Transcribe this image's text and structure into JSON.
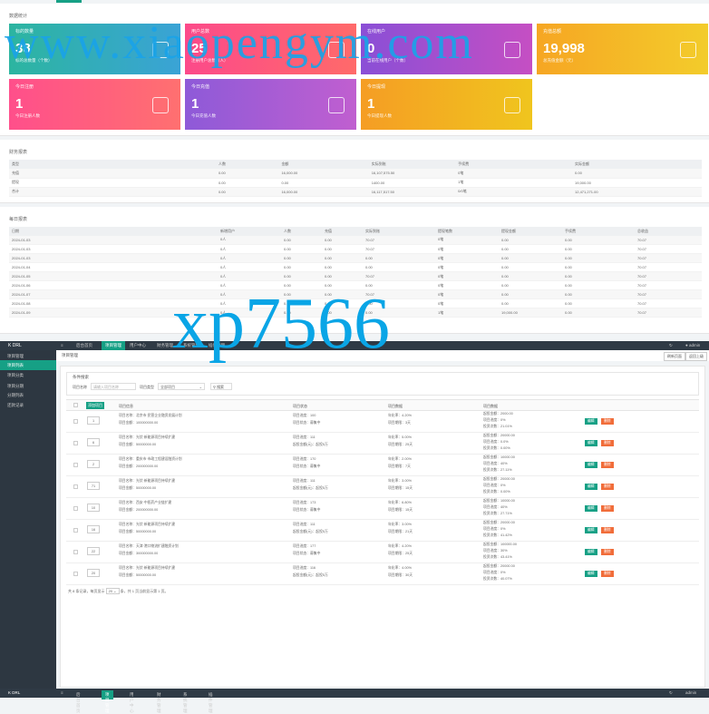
{
  "stats": {
    "title": "数据统计",
    "cards": [
      {
        "label": "标的数量",
        "value": "38",
        "sub": "标的总数量（个数）",
        "icon": "layers-icon",
        "cls": "g1"
      },
      {
        "label": "用户总数",
        "value": "25",
        "sub": "注册用户总数（人）",
        "icon": "user-icon",
        "cls": "g2"
      },
      {
        "label": "在线用户",
        "value": "0",
        "sub": "当前在线用户（个数）",
        "icon": "book-icon",
        "cls": "g3"
      },
      {
        "label": "充值总额",
        "value": "19,998",
        "sub": "总充值金额（元）",
        "icon": "edit-icon",
        "cls": "g4"
      },
      {
        "label": "今日注册",
        "value": "1",
        "sub": "今日注册人数",
        "icon": "user-icon",
        "cls": "g5"
      },
      {
        "label": "今日充值",
        "value": "1",
        "sub": "今日充值人数",
        "icon": "book-icon",
        "cls": "g6"
      },
      {
        "label": "今日提现",
        "value": "1",
        "sub": "今日提现人数",
        "icon": "edit-icon",
        "cls": "g7"
      }
    ]
  },
  "summary": {
    "title": "财务报表",
    "headers": [
      "类型",
      "",
      "人数",
      "金额",
      "实际到账",
      "",
      "手续费",
      "实际金额"
    ],
    "rows": [
      [
        "充值",
        "",
        "0.00",
        "16,000.00",
        "16,107,575.50",
        "",
        "0笔",
        "0.00"
      ],
      [
        "提现",
        "",
        "0.00",
        "0.00",
        "1400.00",
        "",
        "1笔",
        "19,000.00"
      ],
      [
        "合计",
        "",
        "0.00",
        "16,000.00",
        "16,117,517.50",
        "",
        "0/0笔",
        "12,471,271.00"
      ]
    ]
  },
  "daily": {
    "title": "每日报表",
    "headers": [
      "日期",
      "",
      "新增用户",
      "人数",
      "充值",
      "实际到账",
      "提现笔数",
      "提现金额",
      "手续费",
      "总收益"
    ],
    "rows": [
      [
        "2024-01-03",
        "",
        "0人",
        "0.00",
        "0.00",
        "70.07",
        "0笔",
        "0.00",
        "0.00",
        "70.07"
      ],
      [
        "2024-01-03",
        "",
        "0人",
        "0.00",
        "0.00",
        "70.07",
        "0笔",
        "0.00",
        "0.00",
        "70.07"
      ],
      [
        "2024-01-03",
        "",
        "0人",
        "0.00",
        "0.00",
        "0.00",
        "0笔",
        "0.00",
        "0.00",
        "70.07"
      ],
      [
        "2024-01-04",
        "",
        "0人",
        "0.00",
        "0.00",
        "0.00",
        "0笔",
        "0.00",
        "0.00",
        "70.07"
      ],
      [
        "2024-01-05",
        "",
        "0人",
        "0.00",
        "0.00",
        "70.07",
        "0笔",
        "0.00",
        "0.00",
        "70.07"
      ],
      [
        "2024-01-06",
        "",
        "0人",
        "0.00",
        "0.00",
        "0.00",
        "0笔",
        "0.00",
        "0.00",
        "70.07"
      ],
      [
        "2024-01-07",
        "",
        "0人",
        "0.00",
        "0.00",
        "70.07",
        "0笔",
        "0.00",
        "0.00",
        "70.07"
      ],
      [
        "2024-01-08",
        "",
        "0人",
        "0.00",
        "0.00",
        "0.00",
        "0笔",
        "0.00",
        "0.00",
        "70.07"
      ],
      [
        "2024-01-09",
        "",
        "0人",
        "0.00",
        "0.00",
        "0.00",
        "1笔",
        "19,000.00",
        "0.00",
        "70.07"
      ]
    ]
  },
  "watermark": {
    "line1": "www.xiaopengym.com",
    "line2": "xp7566"
  },
  "nav": {
    "logo": "K DRL",
    "home_icon": "home-icon",
    "items": [
      "后台首页",
      "项目管理",
      "用户中心",
      "财务管理",
      "系统管理",
      "插件管理"
    ],
    "active": 1,
    "user": "admin"
  },
  "sidebar": {
    "groups": [
      {
        "title": "项目管理",
        "items": [
          "项目列表",
          "项目分类"
        ],
        "active": 0
      },
      {
        "title": "项目分期",
        "items": [
          "分期列表",
          "还款记录"
        ]
      }
    ]
  },
  "content": {
    "breadcrumb": "项目管理",
    "btn_refresh": "刷新页面",
    "btn_back": "返回上级",
    "search": {
      "title": "条件搜索",
      "label1": "项目名称",
      "placeholder1": "请输入项目名称",
      "label2": "项目类型",
      "select": "全部项目",
      "button": "搜索"
    },
    "table": {
      "add_label": "添加项目",
      "headers": [
        "项目信息",
        "项目状态",
        "项目数据",
        "项目数据"
      ],
      "rows": [
        {
          "sort": "1",
          "c1": "项目名称：北京市·民营企业融资发展计划",
          "c1b": "项目金额：100000000.00",
          "c2": "项目进度：100",
          "c2b": "项目状态：募集中",
          "c3": "年化率：4.20%",
          "c3b": "项目期限：3天",
          "c4": "起投金额：2000.00",
          "c4b": "项目进度：0%",
          "c4c": "投资次数：21.01%"
        },
        {
          "sort": "6",
          "c1": "项目名称：光伏·新能源项目持续扩建",
          "c1b": "项目金额：50000000.00",
          "c2": "项目进度：111",
          "c2b": "起投金额(元)：起投5万",
          "c3": "年化率：5.00%",
          "c3b": "项目期限：25天",
          "c4": "起投金额：20000.00",
          "c4b": "项目进度：0.0%",
          "c4c": "投资次数：0.00%"
        },
        {
          "sort": "2",
          "c1": "项目名称：重庆市·市政工程建设融资计划",
          "c1b": "项目金额：200000000.00",
          "c2": "项目进度：170",
          "c2b": "项目状态：募集中",
          "c3": "年化率：2.00%",
          "c3b": "项目期限：7天",
          "c4": "起投金额：10000.00",
          "c4b": "项目进度：40%",
          "c4c": "投资次数：27.11%"
        },
        {
          "sort": "71",
          "c1": "项目名称：光伏·新能源项目持续扩建",
          "c1b": "项目金额：50000000.00",
          "c2": "项目进度：111",
          "c2b": "起投金额(元)：起投5万",
          "c3": "年化率：3.00%",
          "c3b": "项目期限：15天",
          "c4": "起投金额：20000.00",
          "c4b": "项目进度：0%",
          "c4c": "投资次数：0.00%"
        },
        {
          "sort": "10",
          "c1": "项目名称：西安·中医药产业链扩建",
          "c1b": "项目金额：200000000.00",
          "c2": "项目进度：173",
          "c2b": "项目状态：募集中",
          "c3": "年化率：6.80%",
          "c3b": "项目期限：15天",
          "c4": "起投金额：10000.00",
          "c4b": "项目进度：40%",
          "c4c": "投资次数：27.71%"
        },
        {
          "sort": "16",
          "c1": "项目名称：光伏·新能源项目持续扩建",
          "c1b": "项目金额：50000000.00",
          "c2": "项目进度：111",
          "c2b": "起投金额(元)：起投5万",
          "c3": "年化率：3.00%",
          "c3b": "项目期限：21天",
          "c4": "起投金额：20000.00",
          "c4b": "项目进度：0%",
          "c4c": "投资次数：41.42%"
        },
        {
          "sort": "22",
          "c1": "项目名称：天津·港口物流扩建融资计划",
          "c1b": "项目金额：300000000.00",
          "c2": "项目进度：177",
          "c2b": "项目状态：募集中",
          "c3": "年化率：4.20%",
          "c3b": "项目期限：25天",
          "c4": "起投金额：100000.00",
          "c4b": "项目进度：30%",
          "c4c": "投资次数：43.41%"
        },
        {
          "sort": "20",
          "c1": "项目名称：光伏·新能源项目持续扩建",
          "c1b": "项目金额：50000000.00",
          "c2": "项目进度：116",
          "c2b": "起投金额(元)：起投5万",
          "c3": "年化率：4.00%",
          "c3b": "项目期限：30天",
          "c4": "起投金额：20000.00",
          "c4b": "项目进度：0%",
          "c4c": "投资次数：40.07%"
        }
      ],
      "edit_label": "编辑",
      "delete_label": "删除"
    },
    "pager": {
      "text": "共 8 条记录，每页显示",
      "size": "20",
      "tail": "条，共 1 页当前显示第 1 页。"
    }
  }
}
